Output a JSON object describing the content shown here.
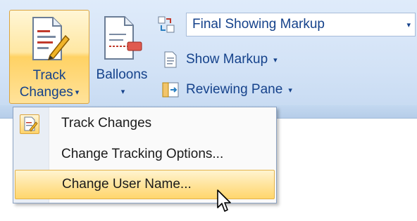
{
  "ribbon": {
    "track_changes": {
      "line1": "Track",
      "line2": "Changes",
      "caret": "▾"
    },
    "balloons": {
      "line1": "Balloons",
      "caret": "▾"
    },
    "display_for_review": {
      "value": "Final Showing Markup",
      "caret": "▾"
    },
    "show_markup": {
      "label": "Show Markup",
      "caret": "▾"
    },
    "reviewing_pane": {
      "label": "Reviewing Pane",
      "caret": "▾"
    }
  },
  "menu": {
    "items": [
      {
        "label": "Track Changes",
        "highlighted": false
      },
      {
        "label": "Change Tracking Options...",
        "highlighted": false
      },
      {
        "label": "Change User Name...",
        "highlighted": true
      }
    ]
  },
  "colors": {
    "accent": "#ffd264",
    "text": "#15428b",
    "ribbon": "#d2e2f6"
  },
  "icons": {
    "track_changes": "document-pencil-icon",
    "balloons": "balloon-document-icon",
    "display_for_review": "compare-icon",
    "show_markup": "document-icon",
    "reviewing_pane": "reviewing-pane-icon",
    "cursor": "mouse-pointer-icon"
  }
}
